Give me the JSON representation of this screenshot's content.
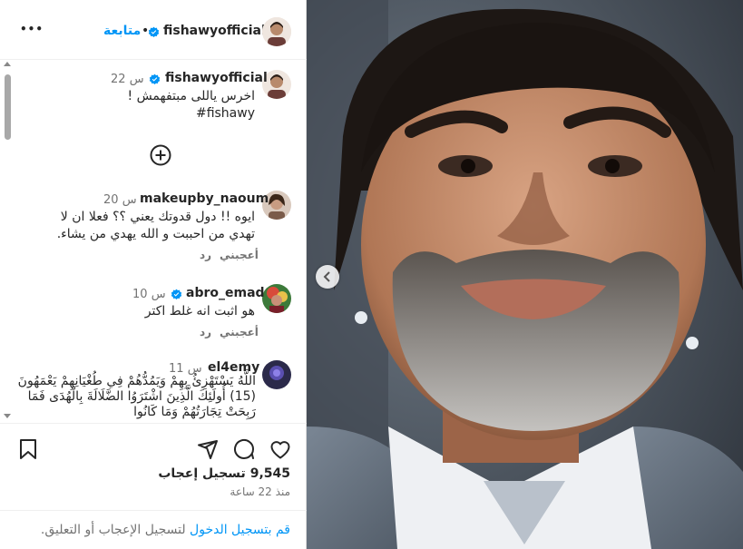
{
  "header": {
    "username": "fishawyofficial",
    "follow_label": "متابعة",
    "more_label": "•••"
  },
  "caption": {
    "username": "fishawyofficial",
    "time": "22 س",
    "text": "اخرس ياللى مبتفهمش !",
    "hashtag": "#fishawy"
  },
  "comments": [
    {
      "username": "makeupby_naoum",
      "time": "20 س",
      "text": "ايوه !! دول قدوتك يعني ؟؟ فعلا ان لا تهدي من احببت و الله يهدي من يشاء.",
      "like_label": "أعجبني",
      "reply_label": "رد"
    },
    {
      "username": "abro_emad",
      "time": "10 س",
      "text": "هو اثبت انه غلط اكتر",
      "like_label": "أعجبني",
      "reply_label": "رد"
    },
    {
      "username": "el4emy",
      "time": "11 س",
      "text": "اللَّهُ يَسْتَهْزِئُ بِهِمْ وَيَمُدُّهُمْ فِي طُغْيَانِهِمْ يَعْمَهُونَ (15) أُولَئِكَ الَّذِينَ اشْتَرَوُا الضَّلَالَةَ بِالْهُدَى فَمَا رَبِحَتْ تِجَارَتُهُمْ وَمَا كَانُوا"
    }
  ],
  "likes": {
    "count": "9,545",
    "label": "تسجيل إعجاب",
    "time": "منذ 22 ساعة"
  },
  "login": {
    "link": "قم بتسجيل الدخول",
    "text": " لتسجيل الإعجاب أو التعليق."
  },
  "colors": {
    "accent": "#0095f6",
    "text": "#262626",
    "muted": "#737373"
  }
}
